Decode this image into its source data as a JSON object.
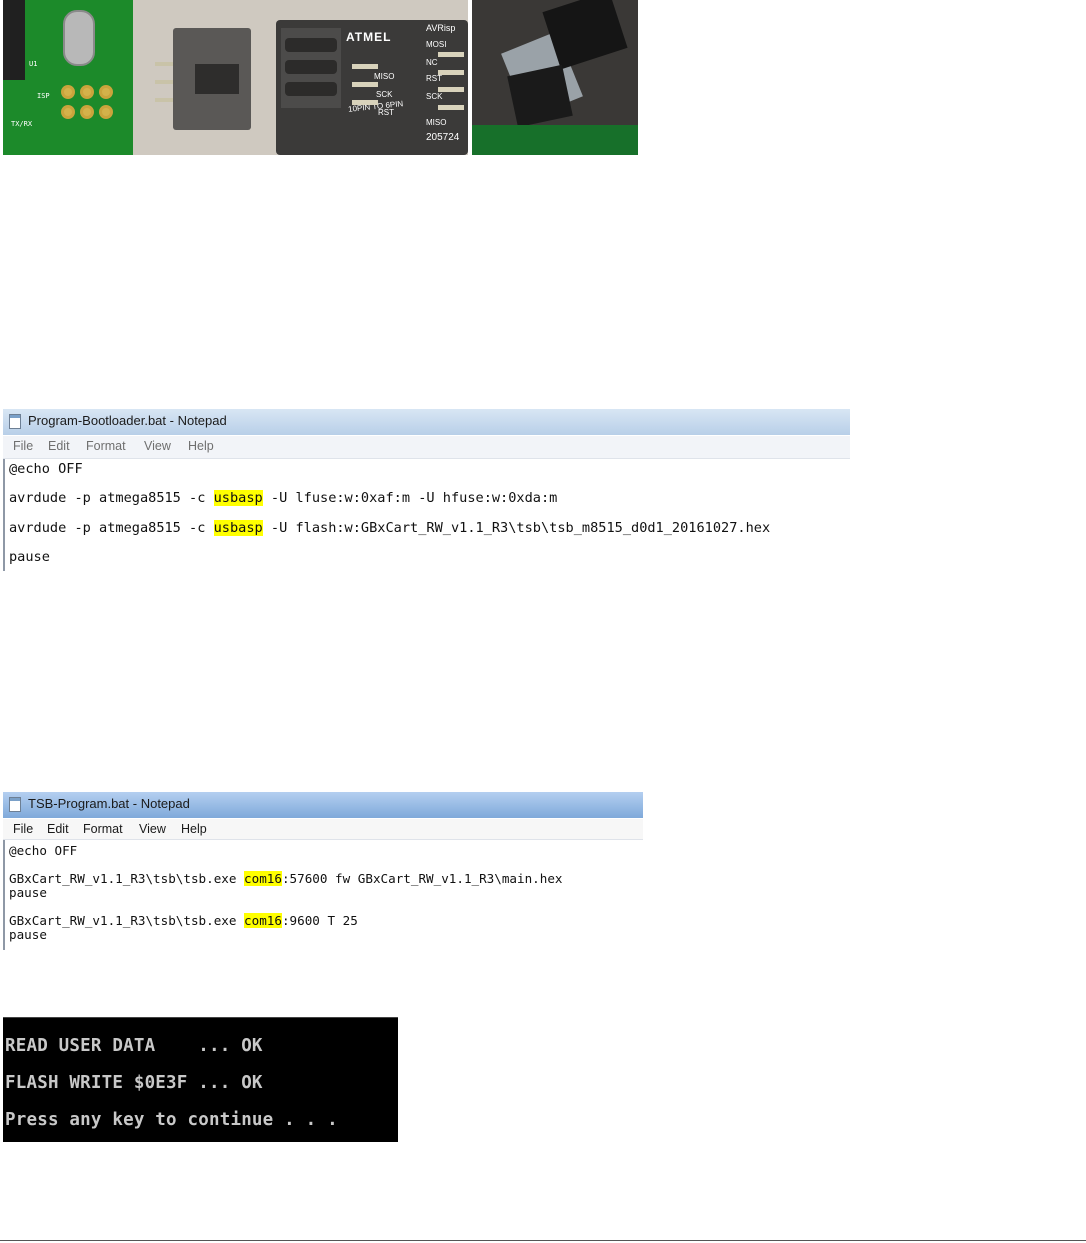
{
  "photo_left": {
    "pcb_labels": [
      "U1",
      "ISP",
      "TX/RX"
    ],
    "adapter_labels": {
      "brand": "ATMEL",
      "left_pins": [
        "MISO",
        "SCK",
        "RST"
      ],
      "right_pins": [
        "AVRisp",
        "MOSI",
        "NC",
        "RST",
        "SCK",
        "MISO"
      ],
      "bottom_text": "10PIN TO 6PIN",
      "part_number": "205724"
    }
  },
  "notepad1": {
    "title": "Program-Bootloader.bat - Notepad",
    "menu": [
      "File",
      "Edit",
      "Format",
      "View",
      "Help"
    ],
    "lines": [
      {
        "pre": "@echo OFF",
        "hl": "",
        "post": ""
      },
      {
        "pre": "avrdude -p atmega8515 -c ",
        "hl": "usbasp",
        "post": " -U lfuse:w:0xaf:m -U hfuse:w:0xda:m"
      },
      {
        "pre": "avrdude -p atmega8515 -c ",
        "hl": "usbasp",
        "post": " -U flash:w:GBxCart_RW_v1.1_R3\\tsb\\tsb_m8515_d0d1_20161027.hex"
      },
      {
        "pre": "pause",
        "hl": "",
        "post": ""
      }
    ]
  },
  "notepad2": {
    "title": "TSB-Program.bat - Notepad",
    "menu": [
      "File",
      "Edit",
      "Format",
      "View",
      "Help"
    ],
    "lines": [
      {
        "pre": "@echo OFF",
        "hl": "",
        "post": ""
      },
      {
        "pre": "GBxCart_RW_v1.1_R3\\tsb\\tsb.exe ",
        "hl": "com16",
        "post": ":57600 fw GBxCart_RW_v1.1_R3\\main.hex"
      },
      {
        "pre": "pause",
        "hl": "",
        "post": ""
      },
      {
        "pre": "GBxCart_RW_v1.1_R3\\tsb\\tsb.exe ",
        "hl": "com16",
        "post": ":9600 T 25"
      },
      {
        "pre": "pause",
        "hl": "",
        "post": ""
      }
    ]
  },
  "console": {
    "lines": [
      "READ USER DATA    ... OK",
      "FLASH WRITE $0E3F ... OK",
      "Press any key to continue . . ."
    ]
  },
  "colors": {
    "highlight": "#ffff00",
    "console_bg": "#000000",
    "console_fg": "#c8c8c8"
  }
}
